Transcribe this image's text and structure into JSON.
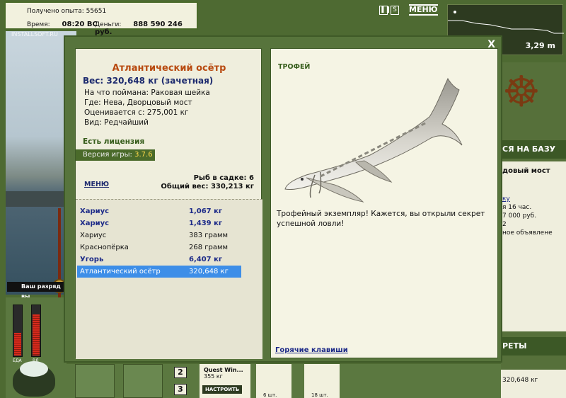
{
  "hud": {
    "exp_label": "Получено опыта: 55651",
    "time_label": "Время:",
    "time_value": "08:20 ВС",
    "money_label": "Деньги:",
    "money_value": "888 590 246 руб.",
    "menu_label": "МЕНЮ",
    "ctrl_s": "S",
    "watermark": "INSTALLSOFT.RU"
  },
  "depth": {
    "value": "3,29 m"
  },
  "right_panel": {
    "band1": "СЯ НА БАЗУ",
    "place": "довый мост",
    "line_1": "ку",
    "line_2": "я 16 час.",
    "line_3": "7 000 руб.",
    "line_4": "2",
    "line_5": "ное объявлене",
    "band2": "РЕТЫ",
    "total": "320,648 кг"
  },
  "bottom": {
    "bar1_label": "ЕДА",
    "bar2_label": "ВД",
    "rank_tip": "Ваш разряд вы",
    "num2": "2",
    "num3": "3",
    "quest_title": "Quest Win...",
    "quest_weight": "355 кг",
    "quest_button": "НАСТРОИТЬ",
    "slot1_count": "6 шт.",
    "slot2_count": "18 шт."
  },
  "dialog": {
    "close_label": "X",
    "fish_name": "Атлантический осётр",
    "weight_line": "Вес: 320,648 кг (зачетная)",
    "bait_line": "На что поймана: Раковая шейка",
    "place_line": "Где: Нева, Дворцовый мост",
    "value_line": "Оценивается с: 275,001 кг",
    "kind_line": "Вид: Редчайший",
    "license": "Есть лицензия",
    "version_label": "Версия игры:",
    "version_value": "3.7.6",
    "menu_link": "МЕНЮ",
    "cage_count": "Рыб в садке: 6",
    "cage_total": "Общий вес: 330,213 кг",
    "catch_list": [
      {
        "name": "Хариус",
        "weight": "1,067 кг",
        "bold": true,
        "selected": false
      },
      {
        "name": "Хариус",
        "weight": "1,439 кг",
        "bold": true,
        "selected": false
      },
      {
        "name": "Хариус",
        "weight": "383 грамм",
        "bold": false,
        "selected": false
      },
      {
        "name": "Краснопёрка",
        "weight": "268 грамм",
        "bold": false,
        "selected": false
      },
      {
        "name": "Угорь",
        "weight": "6,407 кг",
        "bold": true,
        "selected": false
      },
      {
        "name": "Атлантический осётр",
        "weight": "320,648 кг",
        "bold": false,
        "selected": true
      }
    ],
    "trophy_title": "ТРОФЕЙ",
    "trophy_text": "Трофейный экземпляр! Кажется, вы открыли секрет успешной ловли!",
    "hotkeys": "Горячие клавиши"
  },
  "colors": {
    "frame_green": "#57743c",
    "paper": "#efeedd",
    "fish_name_orange": "#b84a10",
    "list_bold_blue": "#1c2a88",
    "selection_blue": "#3d8ee8"
  }
}
